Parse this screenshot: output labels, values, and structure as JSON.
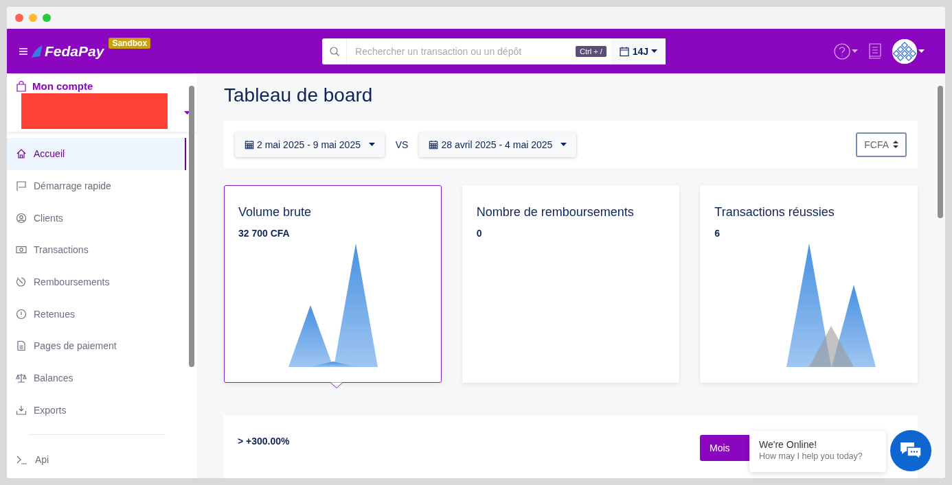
{
  "header": {
    "logo": "FedaPay",
    "badge": "Sandbox",
    "search": {
      "placeholder": "Rechercher un transaction ou un dépôt"
    },
    "shortcut": "Ctrl + /",
    "period": "14J"
  },
  "sidebar": {
    "account_label": "Mon compte",
    "items": [
      {
        "label": "Accueil",
        "selected": true
      },
      {
        "label": "Démarrage rapide",
        "selected": false
      },
      {
        "label": "Clients",
        "selected": false
      },
      {
        "label": "Transactions",
        "selected": false
      },
      {
        "label": "Remboursements",
        "selected": false
      },
      {
        "label": "Retenues",
        "selected": false
      },
      {
        "label": "Pages de paiement",
        "selected": false
      },
      {
        "label": "Balances",
        "selected": false
      },
      {
        "label": "Exports",
        "selected": false
      }
    ],
    "footer_items": [
      {
        "label": "Api",
        "selected": false
      }
    ]
  },
  "main": {
    "title": "Tableau de board",
    "period_current": "2 mai 2025 - 9 mai 2025",
    "vs": "VS",
    "period_previous": "28 avril 2025 - 4 mai 2025",
    "currency": "FCFA",
    "cards": [
      {
        "title": "Volume brute",
        "value": "32 700 CFA",
        "kind": "sparkline",
        "selected": true
      },
      {
        "title": "Nombre de remboursements",
        "value": "0",
        "kind": "empty",
        "selected": false
      },
      {
        "title": "Transactions réussies",
        "value": "6",
        "kind": "sparkline",
        "selected": false
      }
    ],
    "comparison": {
      "value": "> +300.00%",
      "button": "Mois"
    }
  },
  "chat": {
    "title": "We're Online!",
    "subtitle": "How may I help you today?"
  }
}
